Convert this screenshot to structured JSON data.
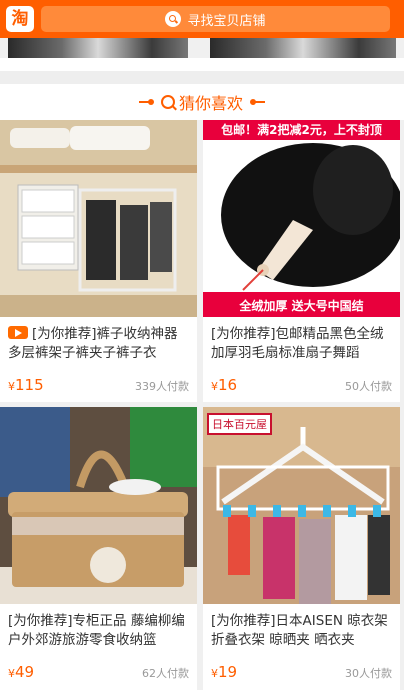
{
  "topbar": {
    "logo": "淘",
    "search_placeholder": "寻找宝贝店铺"
  },
  "section": {
    "title": "猜你喜欢"
  },
  "products": [
    {
      "title": "[为你推荐]裤子收纳神器多层裤架子裤夹子裤子衣",
      "has_video": true,
      "price_symbol": "¥",
      "price": "115",
      "sold": "339人付款"
    },
    {
      "title": "[为你推荐]包邮精品黑色全绒加厚羽毛扇标准扇子舞蹈",
      "has_video": false,
      "price_symbol": "¥",
      "price": "16",
      "sold": "50人付款",
      "banner_top": "包邮！满2把减2元，上不封顶",
      "banner_bottom": "全绒加厚 送大号中国结"
    },
    {
      "title": "[为你推荐]专柜正品 藤编柳编户外郊游旅游零食收纳篮",
      "has_video": false,
      "price_symbol": "¥",
      "price": "49",
      "sold": "62人付款"
    },
    {
      "title": "[为你推荐]日本AISEN 晾衣架 折叠衣架 晾晒夹 晒衣夹",
      "has_video": false,
      "price_symbol": "¥",
      "price": "19",
      "sold": "30人付款",
      "brand_label": "日本百元屋"
    }
  ]
}
